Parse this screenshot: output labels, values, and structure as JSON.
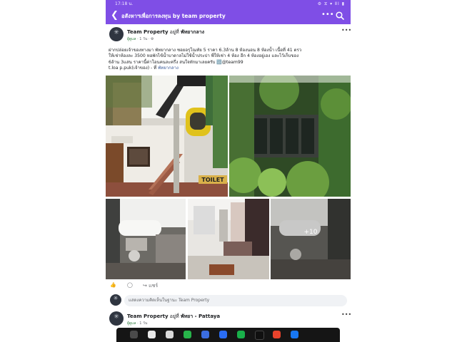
{
  "status_bar": {
    "time": "17:18 น.",
    "system_icons": "⚙ ⧖ ▾ ⅡⅠ ▮"
  },
  "header": {
    "title": "อสังหาฯเพื่อการลงทุน  by team property"
  },
  "post": {
    "author": "Team Property",
    "location_prefix": "อยู่ที่",
    "location": "พัทยากลาง",
    "role": "ผู้ดูแล",
    "time": "1 วัน",
    "text_line1": "ฝากปล่อยเจ้าของทางมา  พัทยากลาง ซอยอรุโณทัย 5 ราคา 6.3ล้าน 8 ห้องนอน 8 ห้องน้ำ เนื้อที่ 41 ตรว",
    "text_line2": "ให้เช่าห้องละ 3500 หอพักไข้น้ำบาดาลไม่ใช้น้ำประปา พี่ให้เช่า 4 ห้อง อีก 4 ห้องอยู่เอง และไว้เก็บของ",
    "text_line3": "6ล้าน 3แสน ราคานี้ค่าโอนคนละครึ่ง สนใจทักมาเลยครับ 🔢@team99",
    "text_line4_prefix": "t.loa p.puk(เจ้าของ) - ที่",
    "text_line4_tag": "พัทยากลาง",
    "more_photos": "+10",
    "toilet_sign": "TOILET",
    "share_label": "แชร์",
    "comment_placeholder": "แสดงความคิดเห็นในฐานะ Team Property"
  },
  "next_post": {
    "author": "Team Property",
    "location_prefix": "อยู่ที่",
    "location": "พัทยา - Pattaya",
    "role": "ผู้ดูแล",
    "time": "1 วัน"
  },
  "colors": {
    "header": "#7f4ee6",
    "page_bg": "#e9e9ee",
    "link": "#385898"
  }
}
